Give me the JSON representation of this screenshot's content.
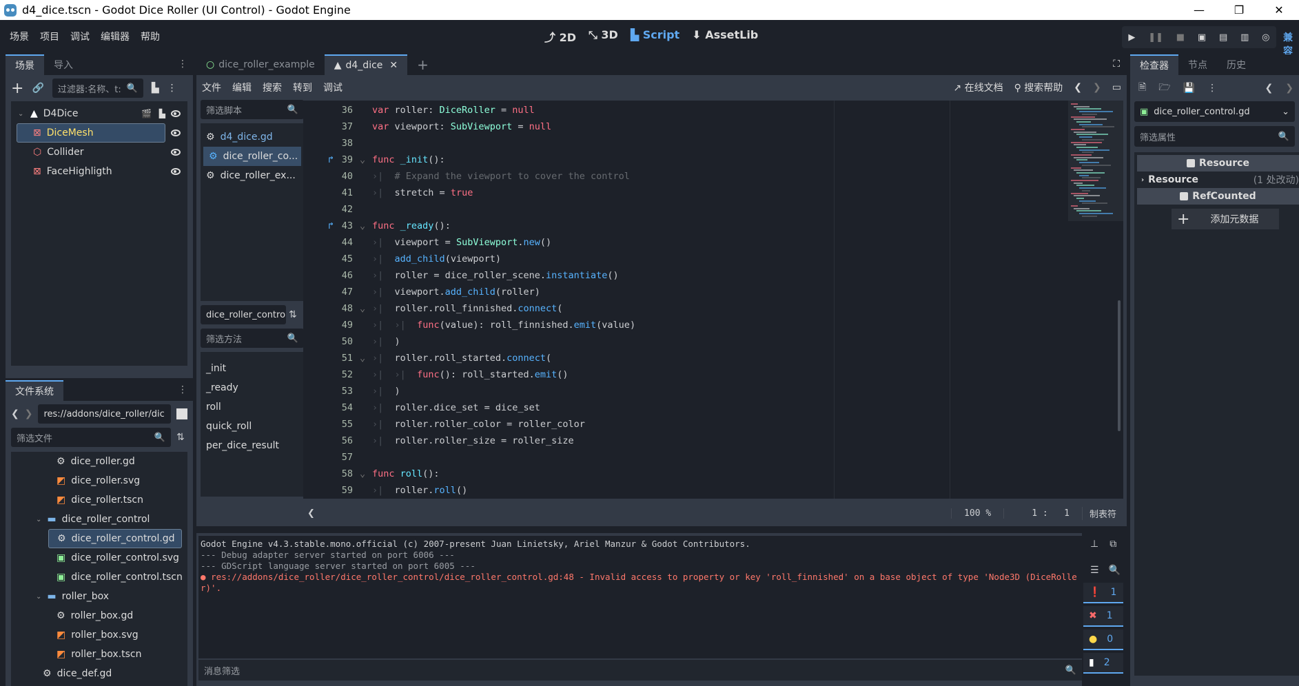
{
  "window": {
    "title": "d4_dice.tscn - Godot Dice Roller (UI Control) - Godot Engine",
    "controls": [
      "minimize",
      "restore",
      "close"
    ]
  },
  "menu": {
    "items": [
      "场景",
      "项目",
      "调试",
      "编辑器",
      "帮助"
    ],
    "workspaces": [
      {
        "label": "2D",
        "icon": "2d-icon",
        "active": false
      },
      {
        "label": "3D",
        "icon": "3d-icon",
        "active": false
      },
      {
        "label": "Script",
        "icon": "script-icon",
        "active": true
      },
      {
        "label": "AssetLib",
        "icon": "assetlib-icon",
        "active": false
      }
    ],
    "run_buttons": [
      "play",
      "pause",
      "stop",
      "remote-debug",
      "play-scene",
      "play-custom-scene",
      "movie-maker"
    ],
    "renderer_label": "兼容"
  },
  "scene_dock": {
    "tabs": [
      "场景",
      "导入"
    ],
    "filter_placeholder": "过滤器:名称、t:",
    "tree": [
      {
        "name": "D4Dice",
        "icon": "node3d-icon",
        "level": 0,
        "selected": false
      },
      {
        "name": "DiceMesh",
        "icon": "mesh-icon",
        "level": 1,
        "selected": true
      },
      {
        "name": "Collider",
        "icon": "collision-icon",
        "level": 1,
        "selected": false
      },
      {
        "name": "FaceHighligth",
        "icon": "mesh-icon",
        "level": 1,
        "selected": false
      }
    ]
  },
  "filesystem_dock": {
    "tab": "文件系统",
    "path": "res://addons/dice_roller/dic",
    "filter_placeholder": "筛选文件",
    "files": [
      {
        "name": "dice_roller.gd",
        "type": "script",
        "level": 2
      },
      {
        "name": "dice_roller.svg",
        "type": "svg",
        "level": 2
      },
      {
        "name": "dice_roller.tscn",
        "type": "scene",
        "level": 2
      },
      {
        "name": "dice_roller_control",
        "type": "folder",
        "level": 1
      },
      {
        "name": "dice_roller_control.gd",
        "type": "script",
        "level": 2,
        "selected": true
      },
      {
        "name": "dice_roller_control.svg",
        "type": "svg-green",
        "level": 2
      },
      {
        "name": "dice_roller_control.tscn",
        "type": "scene-green",
        "level": 2
      },
      {
        "name": "roller_box",
        "type": "folder",
        "level": 1
      },
      {
        "name": "roller_box.gd",
        "type": "script",
        "level": 2
      },
      {
        "name": "roller_box.svg",
        "type": "svg",
        "level": 2
      },
      {
        "name": "roller_box.tscn",
        "type": "scene",
        "level": 2
      },
      {
        "name": "dice_def.gd",
        "type": "script",
        "level": 1
      }
    ]
  },
  "scene_tabs": [
    {
      "label": "dice_roller_example",
      "active": false
    },
    {
      "label": "d4_dice",
      "active": true
    }
  ],
  "script_menu": [
    "文件",
    "编辑",
    "搜索",
    "转到",
    "调试"
  ],
  "script_toolbar": {
    "online_docs": "在线文档",
    "search_help": "搜索帮助"
  },
  "script_list": {
    "filter_placeholder": "筛选脚本",
    "scripts": [
      {
        "name": "d4_dice.gd",
        "active": false
      },
      {
        "name": "dice_roller_co...",
        "active": true
      },
      {
        "name": "dice_roller_ex...",
        "active": false
      }
    ],
    "current": "dice_roller_contro",
    "method_filter_placeholder": "筛选方法",
    "methods": [
      "_init",
      "_ready",
      "roll",
      "quick_roll",
      "per_dice_result"
    ]
  },
  "code": [
    {
      "n": "36",
      "html": "<span class='kw'>var</span> roller: <span class='ty'>DiceRoller</span> = <span class='kw'>null</span>"
    },
    {
      "n": "37",
      "html": "<span class='kw'>var</span> viewport: <span class='ty'>SubViewport</span> = <span class='kw'>null</span>"
    },
    {
      "n": "38",
      "html": ""
    },
    {
      "n": "39",
      "override": true,
      "fold": true,
      "html": "<span class='kw'>func</span> <span class='fnd'>_init</span>():"
    },
    {
      "n": "40",
      "indent": 1,
      "html": "<span class='cm'># Expand the viewport to cover the control</span>"
    },
    {
      "n": "41",
      "indent": 1,
      "html": "stretch = <span class='kw'>true</span>"
    },
    {
      "n": "42",
      "html": ""
    },
    {
      "n": "43",
      "override": true,
      "fold": true,
      "html": "<span class='kw'>func</span> <span class='fnd'>_ready</span>():"
    },
    {
      "n": "44",
      "indent": 1,
      "html": "viewport = <span class='ty'>SubViewport</span>.<span class='fn'>new</span>()"
    },
    {
      "n": "45",
      "indent": 1,
      "html": "<span class='fn'>add_child</span>(viewport)"
    },
    {
      "n": "46",
      "indent": 1,
      "html": "roller = dice_roller_scene.<span class='fn'>instantiate</span>()"
    },
    {
      "n": "47",
      "indent": 1,
      "html": "viewport.<span class='fn'>add_child</span>(roller)"
    },
    {
      "n": "48",
      "indent": 1,
      "fold": true,
      "html": "roller.roll_finnished.<span class='fn'>connect</span>("
    },
    {
      "n": "49",
      "indent": 2,
      "html": "<span class='kw'>func</span>(value): roll_finnished.<span class='fn'>emit</span>(value)"
    },
    {
      "n": "50",
      "indent": 1,
      "html": ")"
    },
    {
      "n": "51",
      "indent": 1,
      "fold": true,
      "html": "roller.roll_started.<span class='fn'>connect</span>("
    },
    {
      "n": "52",
      "indent": 2,
      "html": "<span class='kw'>func</span>(): roll_started.<span class='fn'>emit</span>()"
    },
    {
      "n": "53",
      "indent": 1,
      "html": ")"
    },
    {
      "n": "54",
      "indent": 1,
      "html": "roller.dice_set = dice_set"
    },
    {
      "n": "55",
      "indent": 1,
      "html": "roller.roller_color = roller_color"
    },
    {
      "n": "56",
      "indent": 1,
      "html": "roller.roller_size = roller_size"
    },
    {
      "n": "57",
      "html": ""
    },
    {
      "n": "58",
      "fold": true,
      "html": "<span class='kw'>func</span> <span class='fnd'>roll</span>():"
    },
    {
      "n": "59",
      "indent": 1,
      "html": "roller.<span class='fn'>roll</span>()"
    }
  ],
  "status": {
    "zoom": "100 %",
    "line": "1",
    "col": "1",
    "indent_mode": "制表符"
  },
  "output": {
    "lines": [
      {
        "text": "Godot Engine v4.3.stable.mono.official (c) 2007-present Juan Linietsky, Ariel Manzur & Godot Contributors.",
        "kind": "normal"
      },
      {
        "text": "--- Debug adapter server started on port 6006 ---",
        "kind": "dim"
      },
      {
        "text": "--- GDScript language server started on port 6005 ---",
        "kind": "dim"
      },
      {
        "text": "● res://addons/dice_roller/dice_roller_control/dice_roller_control.gd:48 - Invalid access to property or key 'roll_finnished' on a base object of type 'Node3D (DiceRoller)'.",
        "kind": "error"
      }
    ],
    "filter_placeholder": "消息筛选",
    "counts": {
      "messages": "1",
      "errors": "1",
      "warnings": "0",
      "editor": "2"
    }
  },
  "inspector": {
    "tabs": [
      "检查器",
      "节点",
      "历史"
    ],
    "resource": "dice_roller_control.gd",
    "filter_placeholder": "筛选属性",
    "sections": [
      {
        "kind": "header",
        "label": "Resource"
      },
      {
        "kind": "group",
        "label": "Resource",
        "note": "(1 处改动)"
      },
      {
        "kind": "header",
        "label": "RefCounted"
      }
    ],
    "add_metadata": "添加元数据"
  }
}
